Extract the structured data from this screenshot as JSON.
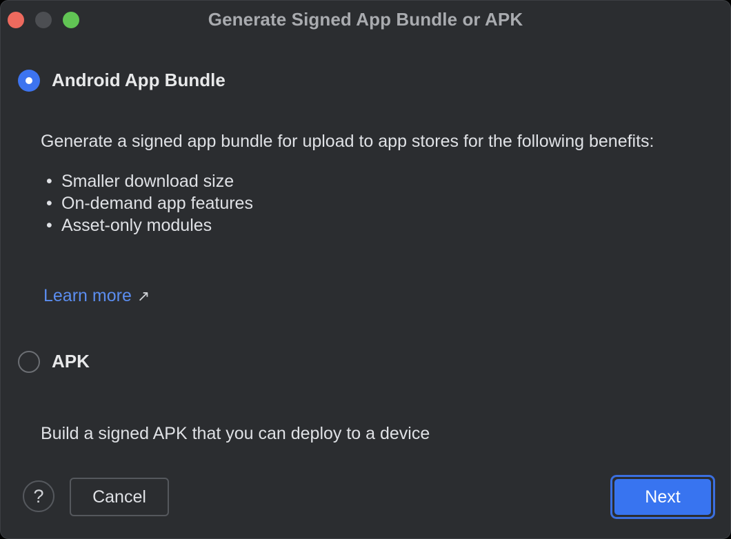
{
  "window": {
    "title": "Generate Signed App Bundle or APK"
  },
  "options": [
    {
      "label": "Android App Bundle",
      "selected": true,
      "description": "Generate a signed app bundle for upload to app stores for the following benefits:",
      "benefits": [
        "Smaller download size",
        "On-demand app features",
        "Asset-only modules"
      ],
      "link": "Learn more"
    },
    {
      "label": "APK",
      "selected": false,
      "description": "Build a signed APK that you can deploy to a device"
    }
  ],
  "footer": {
    "help": "?",
    "cancel": "Cancel",
    "next": "Next"
  },
  "colors": {
    "background": "#2b2d30",
    "accent": "#3874f0",
    "link": "#5b8def"
  },
  "icons": {
    "link_arrow": "external-link-arrow-icon",
    "bullet": "bullet-icon"
  }
}
